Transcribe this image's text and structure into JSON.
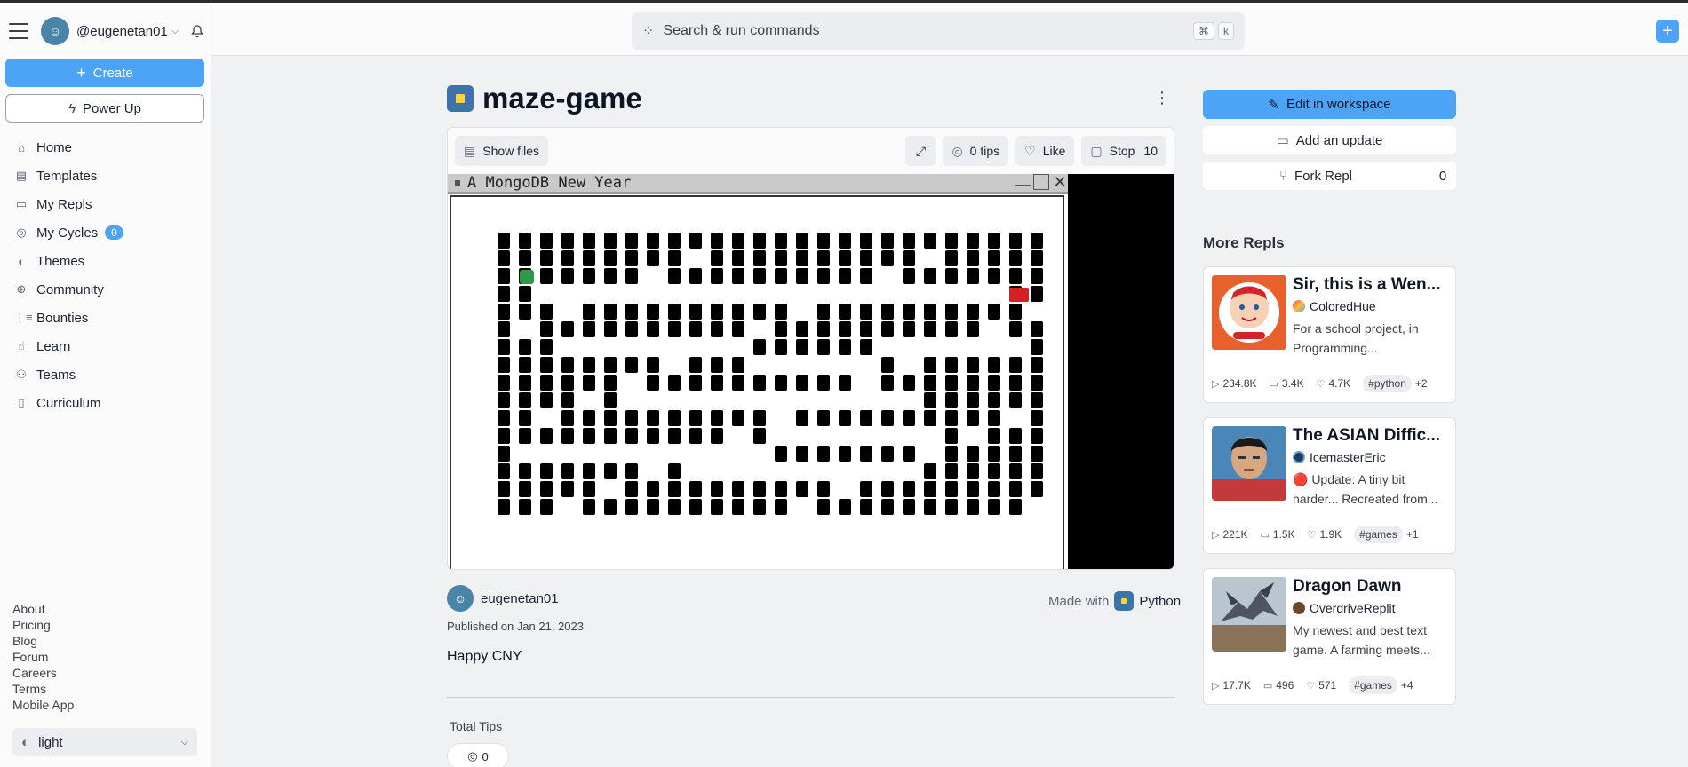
{
  "user": {
    "handle": "@eugenetan01"
  },
  "sidebar": {
    "create_label": "Create",
    "powerup_label": "Power Up",
    "items": [
      {
        "label": "Home",
        "icon": "home-icon"
      },
      {
        "label": "Templates",
        "icon": "templates-icon"
      },
      {
        "label": "My Repls",
        "icon": "folder-icon"
      },
      {
        "label": "My Cycles",
        "icon": "cycles-icon",
        "badge": "0"
      },
      {
        "label": "Themes",
        "icon": "palette-icon"
      },
      {
        "label": "Community",
        "icon": "globe-icon"
      },
      {
        "label": "Bounties",
        "icon": "bounties-icon"
      },
      {
        "label": "Learn",
        "icon": "learn-icon"
      },
      {
        "label": "Teams",
        "icon": "teams-icon"
      },
      {
        "label": "Curriculum",
        "icon": "book-icon"
      }
    ],
    "footer_links": [
      "About",
      "Pricing",
      "Blog",
      "Forum",
      "Careers",
      "Terms",
      "Mobile App"
    ],
    "theme": "light"
  },
  "search": {
    "placeholder": "Search & run commands",
    "kbd1": "⌘",
    "kbd2": "k"
  },
  "repl": {
    "title": "maze-game",
    "show_files": "Show files",
    "tips": "0 tips",
    "like": "Like",
    "stop": "Stop",
    "stop_count": "10",
    "game_window_title": "A MongoDB New Year",
    "author": "eugenetan01",
    "made_with_label": "Made with",
    "language": "Python",
    "published": "Published on Jan 21, 2023",
    "description": "Happy CNY",
    "total_tips_label": "Total Tips",
    "total_tips_value": "0"
  },
  "actions": {
    "edit": "Edit in workspace",
    "update": "Add an update",
    "fork": "Fork Repl",
    "fork_count": "0"
  },
  "more_repls": {
    "title": "More Repls",
    "cards": [
      {
        "title": "Sir, this is a Wen...",
        "user": "ColoredHue",
        "desc": "For a school project, in Programming...",
        "runs": "234.8K",
        "comments": "3.4K",
        "likes": "4.7K",
        "tag": "#python",
        "more_tags": "+2"
      },
      {
        "title": "The ASIAN Diffic...",
        "user": "IcemasterEric",
        "desc": "🔴 Update: A tiny bit harder... Recreated from...",
        "runs": "221K",
        "comments": "1.5K",
        "likes": "1.9K",
        "tag": "#games",
        "more_tags": "+1"
      },
      {
        "title": "Dragon Dawn",
        "user": "OverdriveReplit",
        "desc": "My newest and best text game. A farming meets...",
        "runs": "17.7K",
        "comments": "496",
        "likes": "571",
        "tag": "#games",
        "more_tags": "+4"
      }
    ]
  },
  "colors": {
    "accent": "#4da3f5",
    "background": "#f0f1f2",
    "sidebar": "#fbfbfc"
  }
}
